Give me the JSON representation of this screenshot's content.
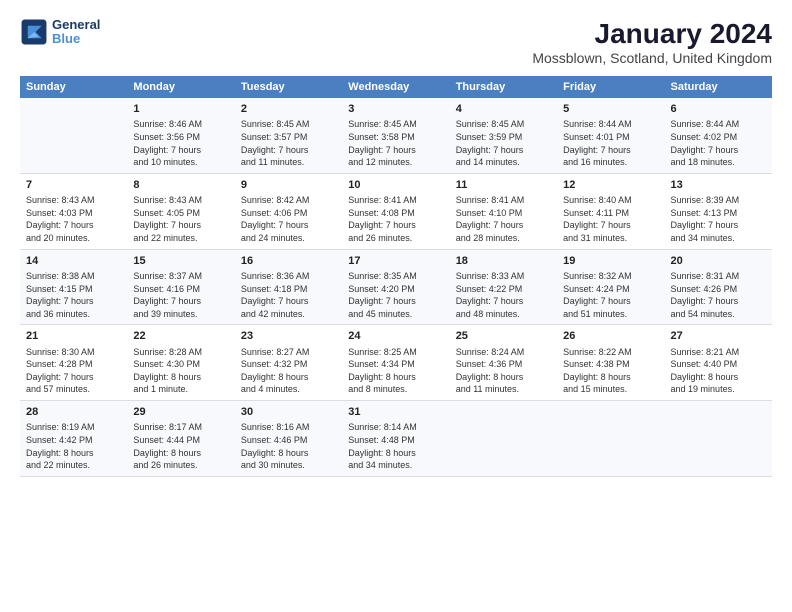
{
  "header": {
    "title": "January 2024",
    "subtitle": "Mossblown, Scotland, United Kingdom"
  },
  "logo": {
    "line1": "General",
    "line2": "Blue"
  },
  "columns": [
    "Sunday",
    "Monday",
    "Tuesday",
    "Wednesday",
    "Thursday",
    "Friday",
    "Saturday"
  ],
  "weeks": [
    [
      {
        "day": "",
        "info": ""
      },
      {
        "day": "1",
        "info": "Sunrise: 8:46 AM\nSunset: 3:56 PM\nDaylight: 7 hours\nand 10 minutes."
      },
      {
        "day": "2",
        "info": "Sunrise: 8:45 AM\nSunset: 3:57 PM\nDaylight: 7 hours\nand 11 minutes."
      },
      {
        "day": "3",
        "info": "Sunrise: 8:45 AM\nSunset: 3:58 PM\nDaylight: 7 hours\nand 12 minutes."
      },
      {
        "day": "4",
        "info": "Sunrise: 8:45 AM\nSunset: 3:59 PM\nDaylight: 7 hours\nand 14 minutes."
      },
      {
        "day": "5",
        "info": "Sunrise: 8:44 AM\nSunset: 4:01 PM\nDaylight: 7 hours\nand 16 minutes."
      },
      {
        "day": "6",
        "info": "Sunrise: 8:44 AM\nSunset: 4:02 PM\nDaylight: 7 hours\nand 18 minutes."
      }
    ],
    [
      {
        "day": "7",
        "info": "Sunrise: 8:43 AM\nSunset: 4:03 PM\nDaylight: 7 hours\nand 20 minutes."
      },
      {
        "day": "8",
        "info": "Sunrise: 8:43 AM\nSunset: 4:05 PM\nDaylight: 7 hours\nand 22 minutes."
      },
      {
        "day": "9",
        "info": "Sunrise: 8:42 AM\nSunset: 4:06 PM\nDaylight: 7 hours\nand 24 minutes."
      },
      {
        "day": "10",
        "info": "Sunrise: 8:41 AM\nSunset: 4:08 PM\nDaylight: 7 hours\nand 26 minutes."
      },
      {
        "day": "11",
        "info": "Sunrise: 8:41 AM\nSunset: 4:10 PM\nDaylight: 7 hours\nand 28 minutes."
      },
      {
        "day": "12",
        "info": "Sunrise: 8:40 AM\nSunset: 4:11 PM\nDaylight: 7 hours\nand 31 minutes."
      },
      {
        "day": "13",
        "info": "Sunrise: 8:39 AM\nSunset: 4:13 PM\nDaylight: 7 hours\nand 34 minutes."
      }
    ],
    [
      {
        "day": "14",
        "info": "Sunrise: 8:38 AM\nSunset: 4:15 PM\nDaylight: 7 hours\nand 36 minutes."
      },
      {
        "day": "15",
        "info": "Sunrise: 8:37 AM\nSunset: 4:16 PM\nDaylight: 7 hours\nand 39 minutes."
      },
      {
        "day": "16",
        "info": "Sunrise: 8:36 AM\nSunset: 4:18 PM\nDaylight: 7 hours\nand 42 minutes."
      },
      {
        "day": "17",
        "info": "Sunrise: 8:35 AM\nSunset: 4:20 PM\nDaylight: 7 hours\nand 45 minutes."
      },
      {
        "day": "18",
        "info": "Sunrise: 8:33 AM\nSunset: 4:22 PM\nDaylight: 7 hours\nand 48 minutes."
      },
      {
        "day": "19",
        "info": "Sunrise: 8:32 AM\nSunset: 4:24 PM\nDaylight: 7 hours\nand 51 minutes."
      },
      {
        "day": "20",
        "info": "Sunrise: 8:31 AM\nSunset: 4:26 PM\nDaylight: 7 hours\nand 54 minutes."
      }
    ],
    [
      {
        "day": "21",
        "info": "Sunrise: 8:30 AM\nSunset: 4:28 PM\nDaylight: 7 hours\nand 57 minutes."
      },
      {
        "day": "22",
        "info": "Sunrise: 8:28 AM\nSunset: 4:30 PM\nDaylight: 8 hours\nand 1 minute."
      },
      {
        "day": "23",
        "info": "Sunrise: 8:27 AM\nSunset: 4:32 PM\nDaylight: 8 hours\nand 4 minutes."
      },
      {
        "day": "24",
        "info": "Sunrise: 8:25 AM\nSunset: 4:34 PM\nDaylight: 8 hours\nand 8 minutes."
      },
      {
        "day": "25",
        "info": "Sunrise: 8:24 AM\nSunset: 4:36 PM\nDaylight: 8 hours\nand 11 minutes."
      },
      {
        "day": "26",
        "info": "Sunrise: 8:22 AM\nSunset: 4:38 PM\nDaylight: 8 hours\nand 15 minutes."
      },
      {
        "day": "27",
        "info": "Sunrise: 8:21 AM\nSunset: 4:40 PM\nDaylight: 8 hours\nand 19 minutes."
      }
    ],
    [
      {
        "day": "28",
        "info": "Sunrise: 8:19 AM\nSunset: 4:42 PM\nDaylight: 8 hours\nand 22 minutes."
      },
      {
        "day": "29",
        "info": "Sunrise: 8:17 AM\nSunset: 4:44 PM\nDaylight: 8 hours\nand 26 minutes."
      },
      {
        "day": "30",
        "info": "Sunrise: 8:16 AM\nSunset: 4:46 PM\nDaylight: 8 hours\nand 30 minutes."
      },
      {
        "day": "31",
        "info": "Sunrise: 8:14 AM\nSunset: 4:48 PM\nDaylight: 8 hours\nand 34 minutes."
      },
      {
        "day": "",
        "info": ""
      },
      {
        "day": "",
        "info": ""
      },
      {
        "day": "",
        "info": ""
      }
    ]
  ]
}
